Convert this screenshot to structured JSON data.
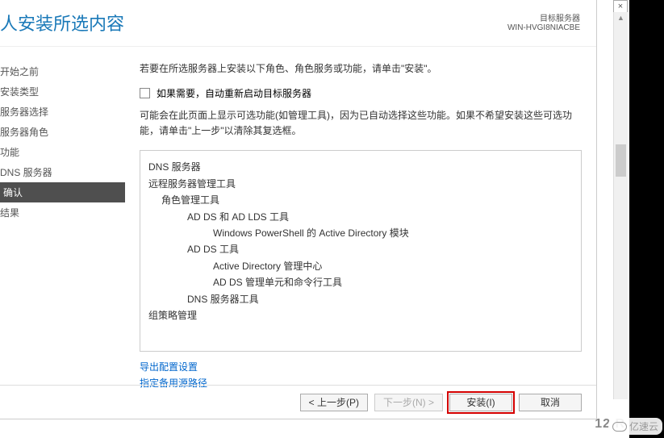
{
  "header": {
    "title": "人安装所选内容",
    "target_label": "目标服务器",
    "target_value": "WIN-HVGI8NIACBE"
  },
  "sidebar": {
    "items": [
      {
        "label": "开始之前"
      },
      {
        "label": "安装类型"
      },
      {
        "label": "服务器选择"
      },
      {
        "label": "服务器角色"
      },
      {
        "label": "功能"
      },
      {
        "label": "DNS 服务器"
      },
      {
        "label": "确认"
      },
      {
        "label": "结果"
      }
    ]
  },
  "main": {
    "intro": "若要在所选服务器上安装以下角色、角色服务或功能，请单击\"安装\"。",
    "checkbox_label": "如果需要，自动重新启动目标服务器",
    "note": "可能会在此页面上显示可选功能(如管理工具)，因为已自动选择这些功能。如果不希望安装这些可选功能，请单击\"上一步\"以清除其复选框。",
    "features": {
      "l0a": "DNS 服务器",
      "l0b": "远程服务器管理工具",
      "l1a": "角色管理工具",
      "l2a": "AD DS 和 AD LDS 工具",
      "l3a": "Windows PowerShell 的 Active Directory 模块",
      "l2b": "AD DS 工具",
      "l3b": "Active Directory 管理中心",
      "l3c": "AD DS 管理单元和命令行工具",
      "l2c": "DNS 服务器工具",
      "l0c": "组策略管理"
    },
    "link_export": "导出配置设置",
    "link_altpath": "指定备用源路径"
  },
  "footer": {
    "prev": "< 上一步(P)",
    "next": "下一步(N) >",
    "install": "安装(I)",
    "cancel": "取消"
  },
  "misc": {
    "close_x": "×",
    "watermark": "12 R",
    "brand": "亿速云"
  }
}
